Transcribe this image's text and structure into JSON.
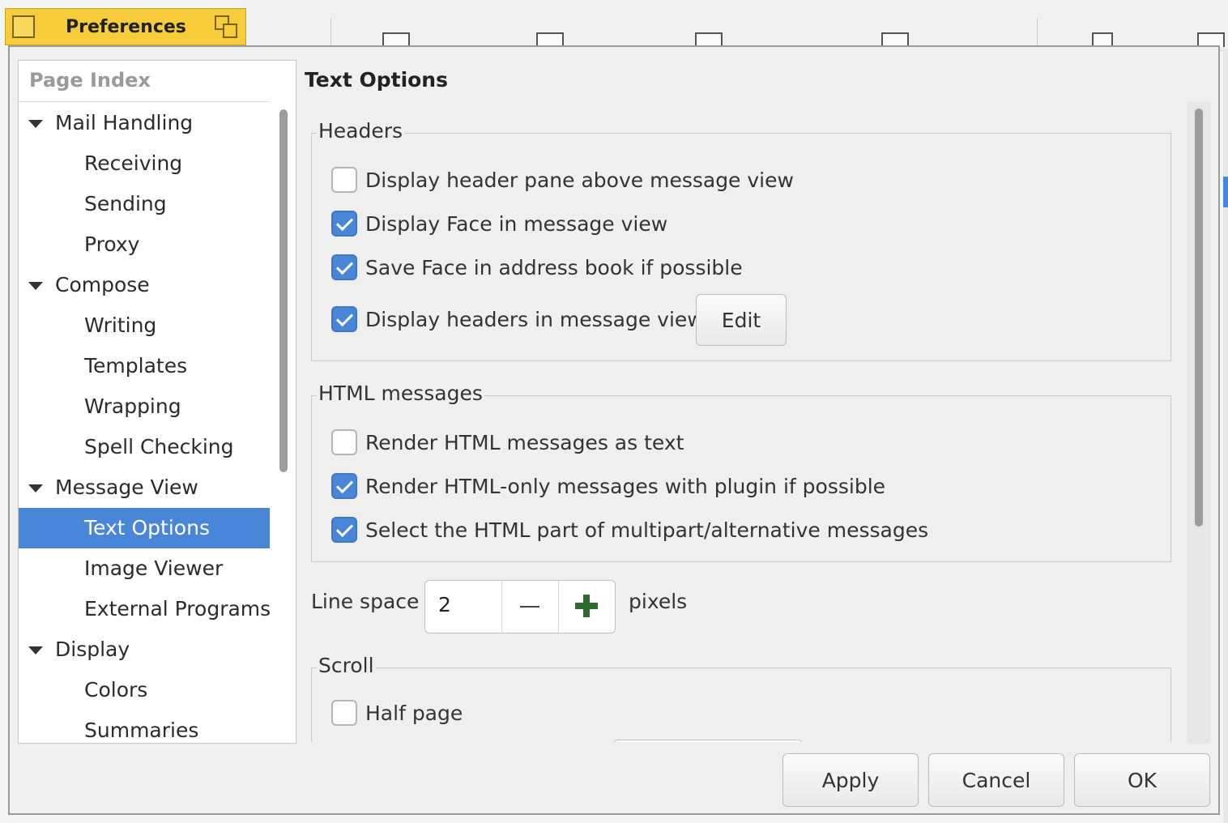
{
  "window": {
    "title": "Preferences"
  },
  "page_index": {
    "header": "Page Index",
    "items": [
      {
        "label": "Mail Handling",
        "level": "parent",
        "expanded": true,
        "selected": false
      },
      {
        "label": "Receiving",
        "level": "child",
        "selected": false
      },
      {
        "label": "Sending",
        "level": "child",
        "selected": false
      },
      {
        "label": "Proxy",
        "level": "child",
        "selected": false
      },
      {
        "label": "Compose",
        "level": "parent",
        "expanded": true,
        "selected": false
      },
      {
        "label": "Writing",
        "level": "child",
        "selected": false
      },
      {
        "label": "Templates",
        "level": "child",
        "selected": false
      },
      {
        "label": "Wrapping",
        "level": "child",
        "selected": false
      },
      {
        "label": "Spell Checking",
        "level": "child",
        "selected": false
      },
      {
        "label": "Message View",
        "level": "parent",
        "expanded": true,
        "selected": false
      },
      {
        "label": "Text Options",
        "level": "child",
        "selected": true
      },
      {
        "label": "Image Viewer",
        "level": "child",
        "selected": false
      },
      {
        "label": "External Programs",
        "level": "child",
        "selected": false
      },
      {
        "label": "Display",
        "level": "parent",
        "expanded": true,
        "selected": false
      },
      {
        "label": "Colors",
        "level": "child",
        "selected": false
      },
      {
        "label": "Summaries",
        "level": "child",
        "selected": false
      }
    ]
  },
  "content": {
    "title": "Text Options",
    "headers_group": {
      "title": "Headers",
      "options": [
        {
          "label": "Display header pane above message view",
          "checked": false
        },
        {
          "label": "Display Face in message view",
          "checked": true
        },
        {
          "label": "Save Face in address book if possible",
          "checked": true
        },
        {
          "label": "Display headers in message view",
          "checked": true
        }
      ],
      "edit_button": "Edit"
    },
    "html_group": {
      "title": "HTML messages",
      "options": [
        {
          "label": "Render HTML messages as text",
          "checked": false
        },
        {
          "label": "Render HTML-only messages with plugin if possible",
          "checked": true
        },
        {
          "label": "Select the HTML part of multipart/alternative messages",
          "checked": true
        }
      ]
    },
    "line_space": {
      "label": "Line space",
      "value": "2",
      "unit": "pixels"
    },
    "scroll_group": {
      "title": "Scroll",
      "options": [
        {
          "label": "Half page",
          "checked": false
        }
      ]
    }
  },
  "buttons": {
    "apply": "Apply",
    "cancel": "Cancel",
    "ok": "OK"
  },
  "colors": {
    "selection": "#4a86d8",
    "titlebar": "#f6cc3a"
  }
}
